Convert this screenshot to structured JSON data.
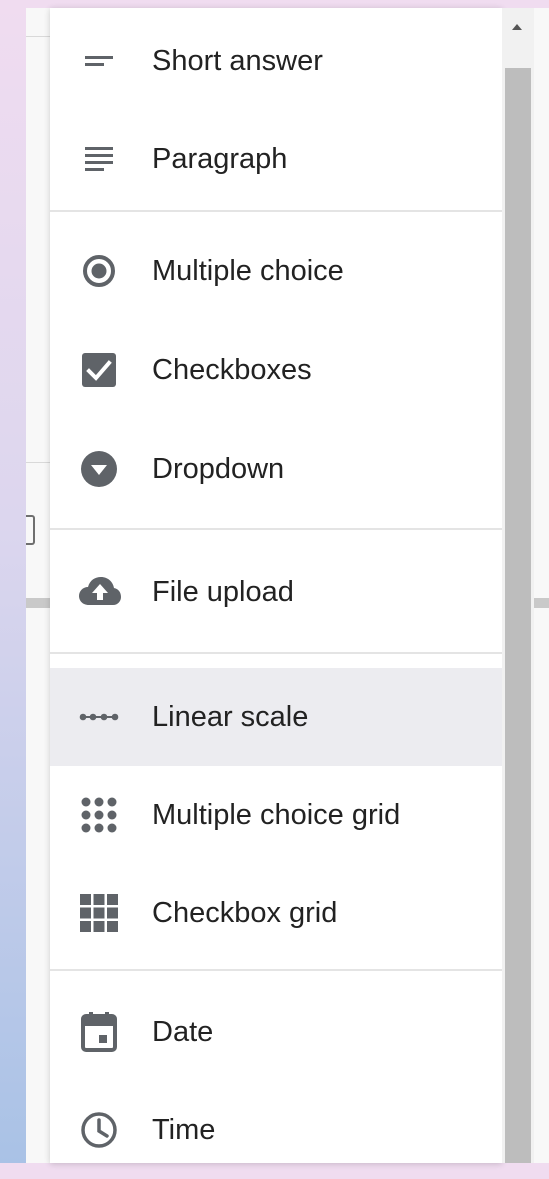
{
  "menu": {
    "groups": [
      {
        "items": [
          {
            "label": "Short answer",
            "icon": "short-answer-icon"
          },
          {
            "label": "Paragraph",
            "icon": "paragraph-icon"
          }
        ]
      },
      {
        "items": [
          {
            "label": "Multiple choice",
            "icon": "radio-button-icon"
          },
          {
            "label": "Checkboxes",
            "icon": "checkbox-icon"
          },
          {
            "label": "Dropdown",
            "icon": "dropdown-icon"
          }
        ]
      },
      {
        "items": [
          {
            "label": "File upload",
            "icon": "cloud-upload-icon"
          }
        ]
      },
      {
        "items": [
          {
            "label": "Linear scale",
            "icon": "linear-scale-icon",
            "highlighted": true
          },
          {
            "label": "Multiple choice grid",
            "icon": "radio-grid-icon"
          },
          {
            "label": "Checkbox grid",
            "icon": "checkbox-grid-icon"
          }
        ]
      },
      {
        "items": [
          {
            "label": "Date",
            "icon": "calendar-icon"
          },
          {
            "label": "Time",
            "icon": "clock-icon"
          }
        ]
      }
    ]
  },
  "colors": {
    "icon": "#5f6368",
    "text": "#222222",
    "highlight": "#ececf0",
    "divider": "#e4e4e4",
    "scroll_thumb": "#bdbdbd"
  }
}
